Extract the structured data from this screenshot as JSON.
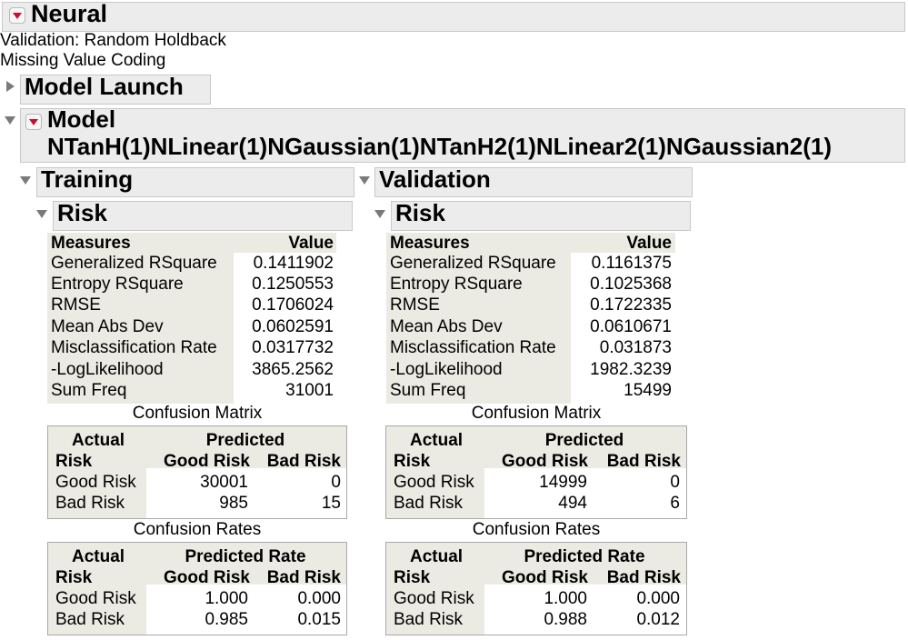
{
  "neural": {
    "title": "Neural",
    "validation_text": "Validation: Random Holdback",
    "missing_text": "Missing Value Coding"
  },
  "model_launch": {
    "title": "Model Launch"
  },
  "model": {
    "title": "Model",
    "subtitle": "NTanH(1)NLinear(1)NGaussian(1)NTanH2(1)NLinear2(1)NGaussian2(1)"
  },
  "training": {
    "title": "Training",
    "risk_title": "Risk",
    "measures_header": "Measures",
    "value_header": "Value",
    "measures": [
      {
        "name": "Generalized RSquare",
        "value": "0.1411902"
      },
      {
        "name": "Entropy RSquare",
        "value": "0.1250553"
      },
      {
        "name": "RMSE",
        "value": "0.1706024"
      },
      {
        "name": "Mean Abs Dev",
        "value": "0.0602591"
      },
      {
        "name": "Misclassification Rate",
        "value": "0.0317732"
      },
      {
        "name": "-LogLikelihood",
        "value": "3865.2562"
      },
      {
        "name": "Sum Freq",
        "value": "31001"
      }
    ],
    "confusion_matrix": {
      "title": "Confusion Matrix",
      "actual": "Actual",
      "predicted": "Predicted",
      "risk": "Risk",
      "col1": "Good Risk",
      "col2": "Bad Risk",
      "rows": [
        {
          "label": "Good Risk",
          "v1": "30001",
          "v2": "0"
        },
        {
          "label": "Bad Risk",
          "v1": "985",
          "v2": "15"
        }
      ]
    },
    "confusion_rates": {
      "title": "Confusion Rates",
      "actual": "Actual",
      "predicted": "Predicted Rate",
      "risk": "Risk",
      "col1": "Good Risk",
      "col2": "Bad Risk",
      "rows": [
        {
          "label": "Good Risk",
          "v1": "1.000",
          "v2": "0.000"
        },
        {
          "label": "Bad Risk",
          "v1": "0.985",
          "v2": "0.015"
        }
      ]
    }
  },
  "validation": {
    "title": "Validation",
    "risk_title": "Risk",
    "measures_header": "Measures",
    "value_header": "Value",
    "measures": [
      {
        "name": "Generalized RSquare",
        "value": "0.1161375"
      },
      {
        "name": "Entropy RSquare",
        "value": "0.1025368"
      },
      {
        "name": "RMSE",
        "value": "0.1722335"
      },
      {
        "name": "Mean Abs Dev",
        "value": "0.0610671"
      },
      {
        "name": "Misclassification Rate",
        "value": "0.031873"
      },
      {
        "name": "-LogLikelihood",
        "value": "1982.3239"
      },
      {
        "name": "Sum Freq",
        "value": "15499"
      }
    ],
    "confusion_matrix": {
      "title": "Confusion Matrix",
      "actual": "Actual",
      "predicted": "Predicted",
      "risk": "Risk",
      "col1": "Good Risk",
      "col2": "Bad Risk",
      "rows": [
        {
          "label": "Good Risk",
          "v1": "14999",
          "v2": "0"
        },
        {
          "label": "Bad Risk",
          "v1": "494",
          "v2": "6"
        }
      ]
    },
    "confusion_rates": {
      "title": "Confusion Rates",
      "actual": "Actual",
      "predicted": "Predicted Rate",
      "risk": "Risk",
      "col1": "Good Risk",
      "col2": "Bad Risk",
      "rows": [
        {
          "label": "Good Risk",
          "v1": "1.000",
          "v2": "0.000"
        },
        {
          "label": "Bad Risk",
          "v1": "0.988",
          "v2": "0.012"
        }
      ]
    }
  }
}
